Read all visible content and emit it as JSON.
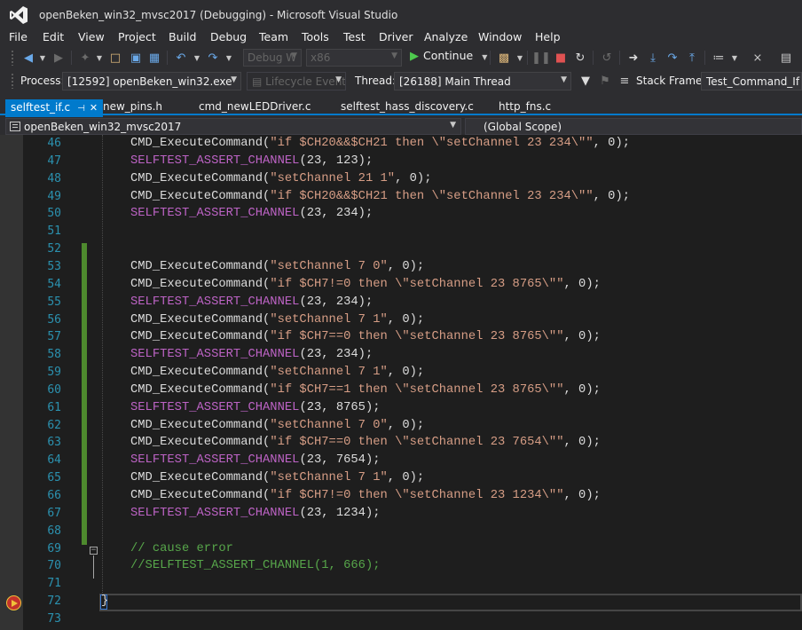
{
  "window": {
    "title": "openBeken_win32_mvsc2017 (Debugging) - Microsoft Visual Studio"
  },
  "menu": [
    "File",
    "Edit",
    "View",
    "Project",
    "Build",
    "Debug",
    "Team",
    "Tools",
    "Test",
    "Driver",
    "Analyze",
    "Window",
    "Help"
  ],
  "toolbar": {
    "config": "Debug W",
    "platform": "x86",
    "continue_label": "Continue"
  },
  "debug_location": {
    "process_label": "Process:",
    "process_value": "[12592] openBeken_win32.exe",
    "lifecycle_label": "Lifecycle Events",
    "thread_label": "Thread:",
    "thread_value": "[26188] Main Thread",
    "stack_frame_label": "Stack Frame:",
    "stack_frame_value": "Test_Command_If"
  },
  "tabs": [
    {
      "label": "selftest_if.c",
      "active": true
    },
    {
      "label": "new_pins.h",
      "active": false
    },
    {
      "label": "cmd_newLEDDriver.c",
      "active": false
    },
    {
      "label": "selftest_hass_discovery.c",
      "active": false
    },
    {
      "label": "http_fns.c",
      "active": false
    }
  ],
  "navigation": {
    "project": "openBeken_win32_mvsc2017",
    "scope": "(Global Scope)"
  },
  "colors": {
    "accent": "#007acc",
    "line_number": "#2b91af",
    "string": "#d69d85",
    "macro": "#bd63c5",
    "comment": "#57a64a",
    "change_marker": "#4e8a2e",
    "breakpoint": "#c3332b"
  },
  "code_lines": [
    {
      "num": "46",
      "tokens": [
        {
          "t": "CMD_ExecuteCommand(",
          "c": ""
        },
        {
          "t": "\"if $CH20&&$CH21 then \\\"setChannel 23 234\\\"\"",
          "c": "tk-str"
        },
        {
          "t": ", 0);",
          "c": ""
        }
      ]
    },
    {
      "num": "47",
      "tokens": [
        {
          "t": "SELFTEST_ASSERT_CHANNEL",
          "c": "tk-macro"
        },
        {
          "t": "(23, 123);",
          "c": ""
        }
      ]
    },
    {
      "num": "48",
      "tokens": [
        {
          "t": "CMD_ExecuteCommand(",
          "c": ""
        },
        {
          "t": "\"setChannel 21 1\"",
          "c": "tk-str"
        },
        {
          "t": ", 0);",
          "c": ""
        }
      ]
    },
    {
      "num": "49",
      "tokens": [
        {
          "t": "CMD_ExecuteCommand(",
          "c": ""
        },
        {
          "t": "\"if $CH20&&$CH21 then \\\"setChannel 23 234\\\"\"",
          "c": "tk-str"
        },
        {
          "t": ", 0);",
          "c": ""
        }
      ]
    },
    {
      "num": "50",
      "tokens": [
        {
          "t": "SELFTEST_ASSERT_CHANNEL",
          "c": "tk-macro"
        },
        {
          "t": "(23, 234);",
          "c": ""
        }
      ]
    },
    {
      "num": "51",
      "tokens": []
    },
    {
      "num": "52",
      "tokens": []
    },
    {
      "num": "53",
      "tokens": [
        {
          "t": "CMD_ExecuteCommand(",
          "c": ""
        },
        {
          "t": "\"setChannel 7 0\"",
          "c": "tk-str"
        },
        {
          "t": ", 0);",
          "c": ""
        }
      ]
    },
    {
      "num": "54",
      "tokens": [
        {
          "t": "CMD_ExecuteCommand(",
          "c": ""
        },
        {
          "t": "\"if $CH7!=0 then \\\"setChannel 23 8765\\\"\"",
          "c": "tk-str"
        },
        {
          "t": ", 0);",
          "c": ""
        }
      ]
    },
    {
      "num": "55",
      "tokens": [
        {
          "t": "SELFTEST_ASSERT_CHANNEL",
          "c": "tk-macro"
        },
        {
          "t": "(23, 234);",
          "c": ""
        }
      ]
    },
    {
      "num": "56",
      "tokens": [
        {
          "t": "CMD_ExecuteCommand(",
          "c": ""
        },
        {
          "t": "\"setChannel 7 1\"",
          "c": "tk-str"
        },
        {
          "t": ", 0);",
          "c": ""
        }
      ]
    },
    {
      "num": "57",
      "tokens": [
        {
          "t": "CMD_ExecuteCommand(",
          "c": ""
        },
        {
          "t": "\"if $CH7==0 then \\\"setChannel 23 8765\\\"\"",
          "c": "tk-str"
        },
        {
          "t": ", 0);",
          "c": ""
        }
      ]
    },
    {
      "num": "58",
      "tokens": [
        {
          "t": "SELFTEST_ASSERT_CHANNEL",
          "c": "tk-macro"
        },
        {
          "t": "(23, 234);",
          "c": ""
        }
      ]
    },
    {
      "num": "59",
      "tokens": [
        {
          "t": "CMD_ExecuteCommand(",
          "c": ""
        },
        {
          "t": "\"setChannel 7 1\"",
          "c": "tk-str"
        },
        {
          "t": ", 0);",
          "c": ""
        }
      ]
    },
    {
      "num": "60",
      "tokens": [
        {
          "t": "CMD_ExecuteCommand(",
          "c": ""
        },
        {
          "t": "\"if $CH7==1 then \\\"setChannel 23 8765\\\"\"",
          "c": "tk-str"
        },
        {
          "t": ", 0);",
          "c": ""
        }
      ]
    },
    {
      "num": "61",
      "tokens": [
        {
          "t": "SELFTEST_ASSERT_CHANNEL",
          "c": "tk-macro"
        },
        {
          "t": "(23, 8765);",
          "c": ""
        }
      ]
    },
    {
      "num": "62",
      "tokens": [
        {
          "t": "CMD_ExecuteCommand(",
          "c": ""
        },
        {
          "t": "\"setChannel 7 0\"",
          "c": "tk-str"
        },
        {
          "t": ", 0);",
          "c": ""
        }
      ]
    },
    {
      "num": "63",
      "tokens": [
        {
          "t": "CMD_ExecuteCommand(",
          "c": ""
        },
        {
          "t": "\"if $CH7==0 then \\\"setChannel 23 7654\\\"\"",
          "c": "tk-str"
        },
        {
          "t": ", 0);",
          "c": ""
        }
      ]
    },
    {
      "num": "64",
      "tokens": [
        {
          "t": "SELFTEST_ASSERT_CHANNEL",
          "c": "tk-macro"
        },
        {
          "t": "(23, 7654);",
          "c": ""
        }
      ]
    },
    {
      "num": "65",
      "tokens": [
        {
          "t": "CMD_ExecuteCommand(",
          "c": ""
        },
        {
          "t": "\"setChannel 7 1\"",
          "c": "tk-str"
        },
        {
          "t": ", 0);",
          "c": ""
        }
      ]
    },
    {
      "num": "66",
      "tokens": [
        {
          "t": "CMD_ExecuteCommand(",
          "c": ""
        },
        {
          "t": "\"if $CH7!=0 then \\\"setChannel 23 1234\\\"\"",
          "c": "tk-str"
        },
        {
          "t": ", 0);",
          "c": ""
        }
      ]
    },
    {
      "num": "67",
      "tokens": [
        {
          "t": "SELFTEST_ASSERT_CHANNEL",
          "c": "tk-macro"
        },
        {
          "t": "(23, 1234);",
          "c": ""
        }
      ]
    },
    {
      "num": "68",
      "tokens": []
    },
    {
      "num": "69",
      "tokens": [
        {
          "t": "// cause error",
          "c": "tk-cmt"
        }
      ]
    },
    {
      "num": "70",
      "tokens": [
        {
          "t": "//SELFTEST_ASSERT_CHANNEL(1, 666);",
          "c": "tk-cmt"
        }
      ]
    },
    {
      "num": "71",
      "tokens": []
    },
    {
      "num": "72",
      "tokens": []
    },
    {
      "num": "73",
      "tokens": []
    }
  ],
  "current_line_text": "}"
}
